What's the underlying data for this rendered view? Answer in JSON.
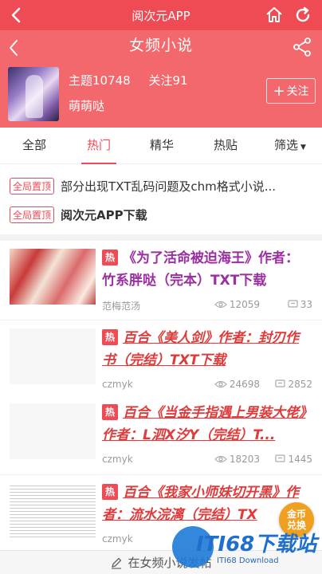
{
  "topbar": {
    "title": "阅次元APP"
  },
  "header": {
    "page_title": "女频小说",
    "topics_label": "主题10748",
    "follows_label": "关注91",
    "moderator": "萌萌哒",
    "follow_button": "关注"
  },
  "tabs": [
    {
      "label": "全部"
    },
    {
      "label": "热门",
      "active": true
    },
    {
      "label": "精华"
    },
    {
      "label": "热贴"
    },
    {
      "label": "筛选"
    }
  ],
  "pinned": [
    {
      "badge": "全局置顶",
      "text": "部分出现TXT乱码问题及chm格式小说..."
    },
    {
      "badge": "全局置顶",
      "text": "阅次元APP下载"
    }
  ],
  "posts": [
    {
      "hot": "热",
      "title": "《为了活命被迫海王》作者：竹系胖哒（完本）TXT下载",
      "author": "范梅范汤",
      "views": "12059",
      "comments": "33"
    },
    {
      "hot": "热",
      "title": "百合《美人剑》作者：封刃作书（完结）TXT下载",
      "author": "czmyk",
      "views": "24698",
      "comments": "2852"
    },
    {
      "hot": "热",
      "title": "百合《当金手指遇上男装大佬》作者：L泗X汐Y（完结）T...",
      "author": "czmyk",
      "views": "18203",
      "comments": "1445"
    },
    {
      "hot": "热",
      "title": "百合《我家小师妹切开黑》作者：流水浣漓（完结）TX",
      "author": "czmyk",
      "views": "",
      "comments": ""
    }
  ],
  "bottom_bar": {
    "text": "在女频小说发帖"
  },
  "coin_badge": {
    "line1": "金币",
    "line2": "兑换"
  },
  "watermark": {
    "brand": "ITI68下载站",
    "sub": "ITI68 Download"
  },
  "colors": {
    "primary": "#ee4b54",
    "header": "#f2686c",
    "hot_title": "#d0326b"
  }
}
